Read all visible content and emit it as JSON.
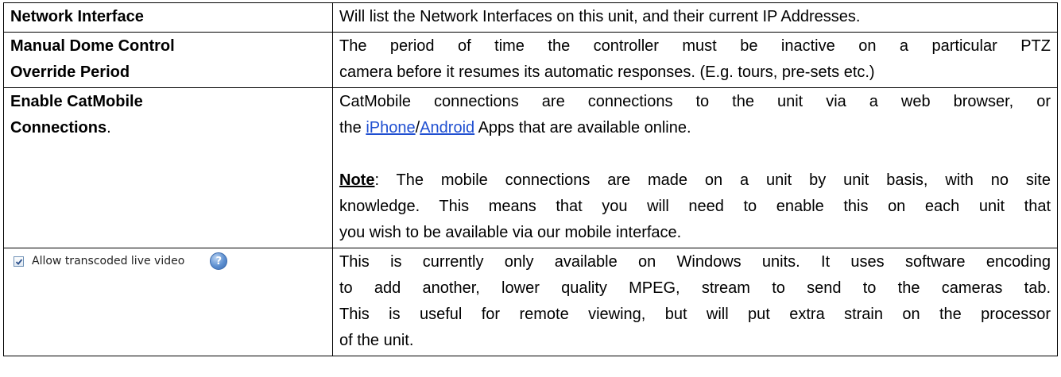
{
  "rows": [
    {
      "term": "Network Interface",
      "description": "Will list the Network Interfaces on this unit, and their current IP Addresses."
    },
    {
      "term_line1": "Manual Dome Control",
      "term_line2": "Override Period",
      "desc_line1": "The period of time the controller must be inactive on a particular PTZ",
      "desc_line2": "camera before it resumes its automatic responses. (E.g. tours, pre-sets etc.)"
    },
    {
      "term_line1": "Enable CatMobile",
      "term_line2": "Connections",
      "term_suffix": ".",
      "desc_line1": "CatMobile connections are connections to the unit via a web browser, or",
      "desc_prefix": "the ",
      "link_iphone": "iPhone",
      "separator": "/",
      "link_android": "Android",
      "desc_suffix": " Apps that are available online.",
      "note_label": "Note",
      "note_line1": ": The mobile connections are made on a unit by unit basis, with no site",
      "note_line2": "knowledge. This means that you will need to enable this on each unit that",
      "note_line3": "you wish to be available via our mobile interface."
    },
    {
      "setting_label": "Allow transcoded live video",
      "setting_checked": true,
      "help_icon_glyph": "?",
      "desc_line1": "This is currently only available on Windows units. It uses software encoding",
      "desc_line2": "to add another, lower quality MPEG, stream to send to the cameras tab.",
      "desc_line3": "This is useful for remote viewing, but will put extra strain on the processor",
      "desc_line4": "of the unit."
    }
  ],
  "colors": {
    "link": "#1f4fd1",
    "border": "#000000"
  }
}
